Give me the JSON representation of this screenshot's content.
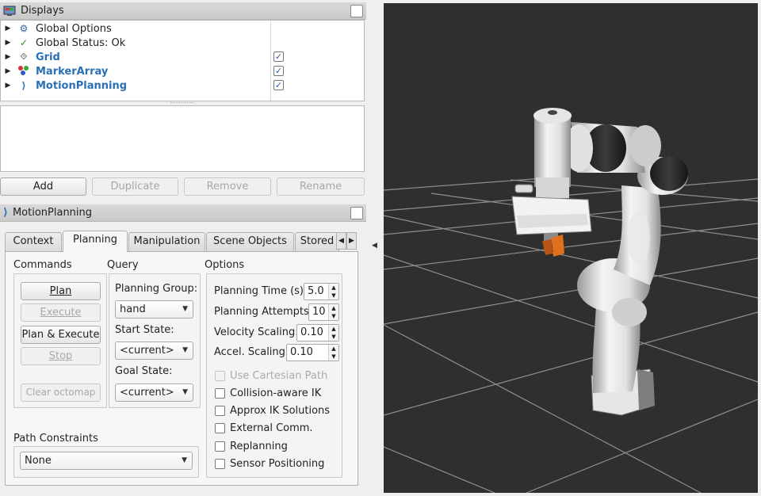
{
  "displays": {
    "title": "Displays",
    "items": [
      {
        "label": "Global Options",
        "icon": "gear-icon",
        "bold": false,
        "checked": null
      },
      {
        "label": "Global Status: Ok",
        "icon": "checkmark-icon",
        "bold": false,
        "checked": null
      },
      {
        "label": "Grid",
        "icon": "grid-icon",
        "bold": true,
        "checked": true
      },
      {
        "label": "MarkerArray",
        "icon": "marker-array-icon",
        "bold": true,
        "checked": true
      },
      {
        "label": "MotionPlanning",
        "icon": "motion-planning-icon",
        "bold": true,
        "checked": true
      }
    ],
    "buttons": {
      "add": "Add",
      "duplicate": "Duplicate",
      "remove": "Remove",
      "rename": "Rename"
    }
  },
  "motion_panel": {
    "title": "MotionPlanning",
    "tabs": [
      "Context",
      "Planning",
      "Manipulation",
      "Scene Objects",
      "Stored"
    ],
    "active_tab": "Planning"
  },
  "commands": {
    "title": "Commands",
    "plan": "Plan",
    "execute": "Execute",
    "plan_execute": "Plan & Execute",
    "stop": "Stop",
    "clear_octomap": "Clear octomap"
  },
  "query": {
    "title": "Query",
    "planning_group_label": "Planning Group:",
    "planning_group_value": "hand",
    "start_state_label": "Start State:",
    "start_state_value": "<current>",
    "goal_state_label": "Goal State:",
    "goal_state_value": "<current>"
  },
  "options": {
    "title": "Options",
    "planning_time_label": "Planning Time (s):",
    "planning_time_value": "5.0",
    "planning_attempts_label": "Planning Attempts:",
    "planning_attempts_value": "10",
    "velocity_scaling_label": "Velocity Scaling:",
    "velocity_scaling_value": "0.10",
    "accel_scaling_label": "Accel. Scaling:",
    "accel_scaling_value": "0.10",
    "checkboxes": [
      {
        "label": "Use Cartesian Path",
        "disabled": true
      },
      {
        "label": "Collision-aware IK",
        "disabled": false
      },
      {
        "label": "Approx IK Solutions",
        "disabled": false
      },
      {
        "label": "External Comm.",
        "disabled": false
      },
      {
        "label": "Replanning",
        "disabled": false
      },
      {
        "label": "Sensor Positioning",
        "disabled": false
      }
    ]
  },
  "path_constraints": {
    "title": "Path Constraints",
    "value": "None"
  },
  "colors": {
    "link_blue": "#2a6fb6",
    "viewport_bg": "#2f2f2f",
    "gripper_accent": "#e0701c"
  }
}
